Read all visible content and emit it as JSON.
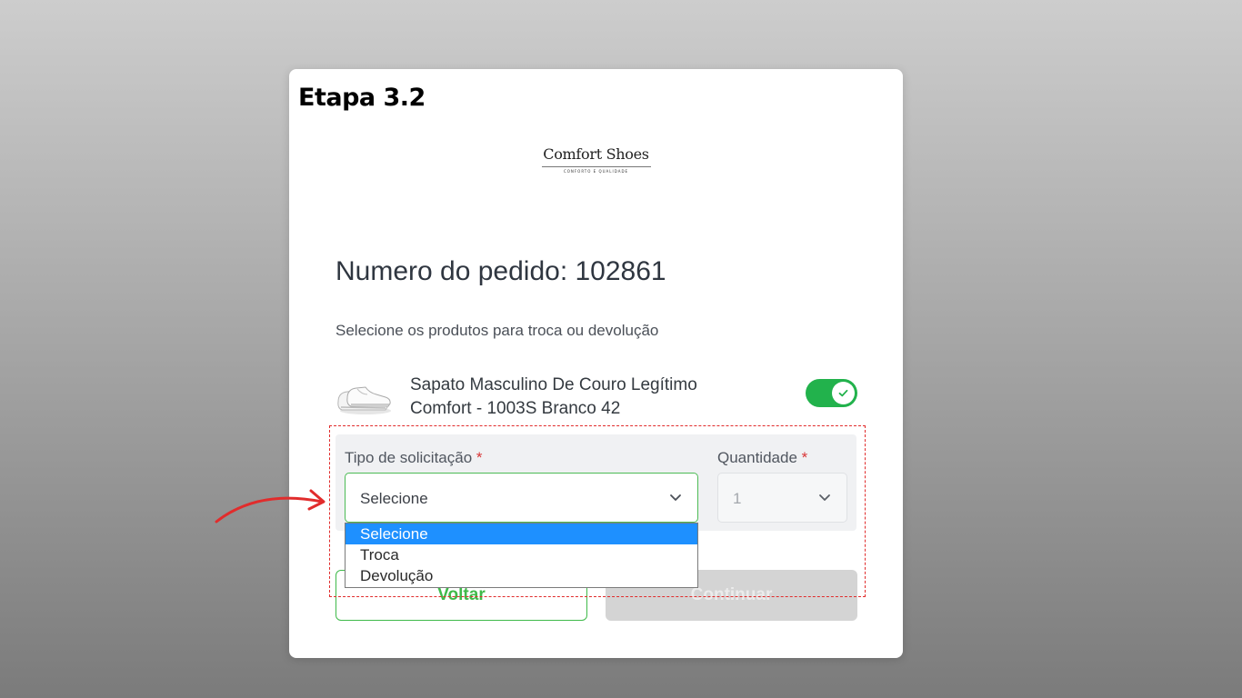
{
  "step_title": "Etapa 3.2",
  "logo": {
    "name": "Comfort Shoes",
    "tagline": "CONFORTO E QUALIDADE"
  },
  "order": {
    "title": "Numero do pedido: 102861"
  },
  "instructions": "Selecione os produtos para troca ou devolução",
  "product": {
    "name_line1": "Sapato Masculino De Couro Legítimo",
    "name_line2": "Comfort - 1003S Branco 42",
    "image_icon": "white-shoes-image",
    "selected": true
  },
  "form": {
    "type_label": "Tipo de solicitação",
    "required_mark": "*",
    "type_value": "Selecione",
    "quantity_label": "Quantidade",
    "quantity_value": "1"
  },
  "dropdown_options": [
    "Selecione",
    "Troca",
    "Devolução"
  ],
  "buttons": {
    "back": "Voltar",
    "continue": "Continuar"
  },
  "colors": {
    "accent_green": "#22b24c",
    "highlight_blue": "#1e90ff",
    "annotation_red": "#e12c2c"
  }
}
